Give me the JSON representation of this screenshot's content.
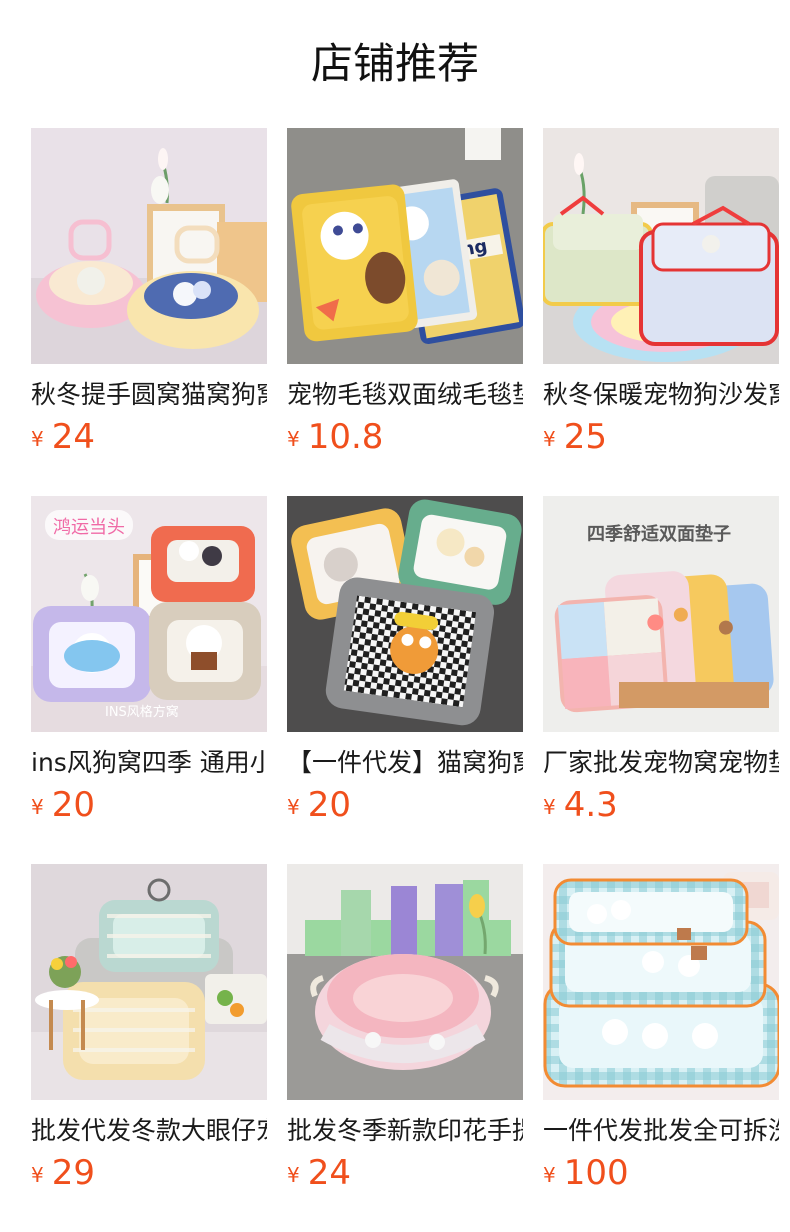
{
  "header": {
    "title": "店铺推荐"
  },
  "products": [
    {
      "name": "秋冬提手圆窝猫窝狗窝",
      "currency": "¥",
      "price": "24",
      "image_icon": "round-pet-beds-photo"
    },
    {
      "name": "宠物毛毯双面绒毛毯垫",
      "currency": "¥",
      "price": "10.8",
      "image_icon": "pet-blankets-photo",
      "image_text": "othing"
    },
    {
      "name": "秋冬保暖宠物狗沙发窝",
      "currency": "¥",
      "price": "25",
      "image_icon": "pet-sofa-beds-photo"
    },
    {
      "name": "ins风狗窝四季 通用小型",
      "currency": "¥",
      "price": "20",
      "image_icon": "ins-style-pet-beds-photo",
      "image_text": "鸿运当头",
      "image_caption": "INS风格方窝"
    },
    {
      "name": "【一件代发】猫窝狗窝",
      "currency": "¥",
      "price": "20",
      "image_icon": "square-pet-beds-photo"
    },
    {
      "name": "厂家批发宠物窝宠物垫",
      "currency": "¥",
      "price": "4.3",
      "image_icon": "pet-pads-photo",
      "image_text": "四季舒适双面垫子"
    },
    {
      "name": "批发代发冬款大眼仔宠",
      "currency": "¥",
      "price": "29",
      "image_icon": "striped-pet-beds-photo"
    },
    {
      "name": "批发冬季新款印花手提",
      "currency": "¥",
      "price": "24",
      "image_icon": "pink-round-pet-bed-photo"
    },
    {
      "name": "一件代发批发全可拆洗",
      "currency": "¥",
      "price": "100",
      "image_icon": "gingham-pet-beds-photo"
    }
  ],
  "colors": {
    "price": "#f04f1c",
    "title": "#111111",
    "product_name": "#1a1a1a"
  }
}
